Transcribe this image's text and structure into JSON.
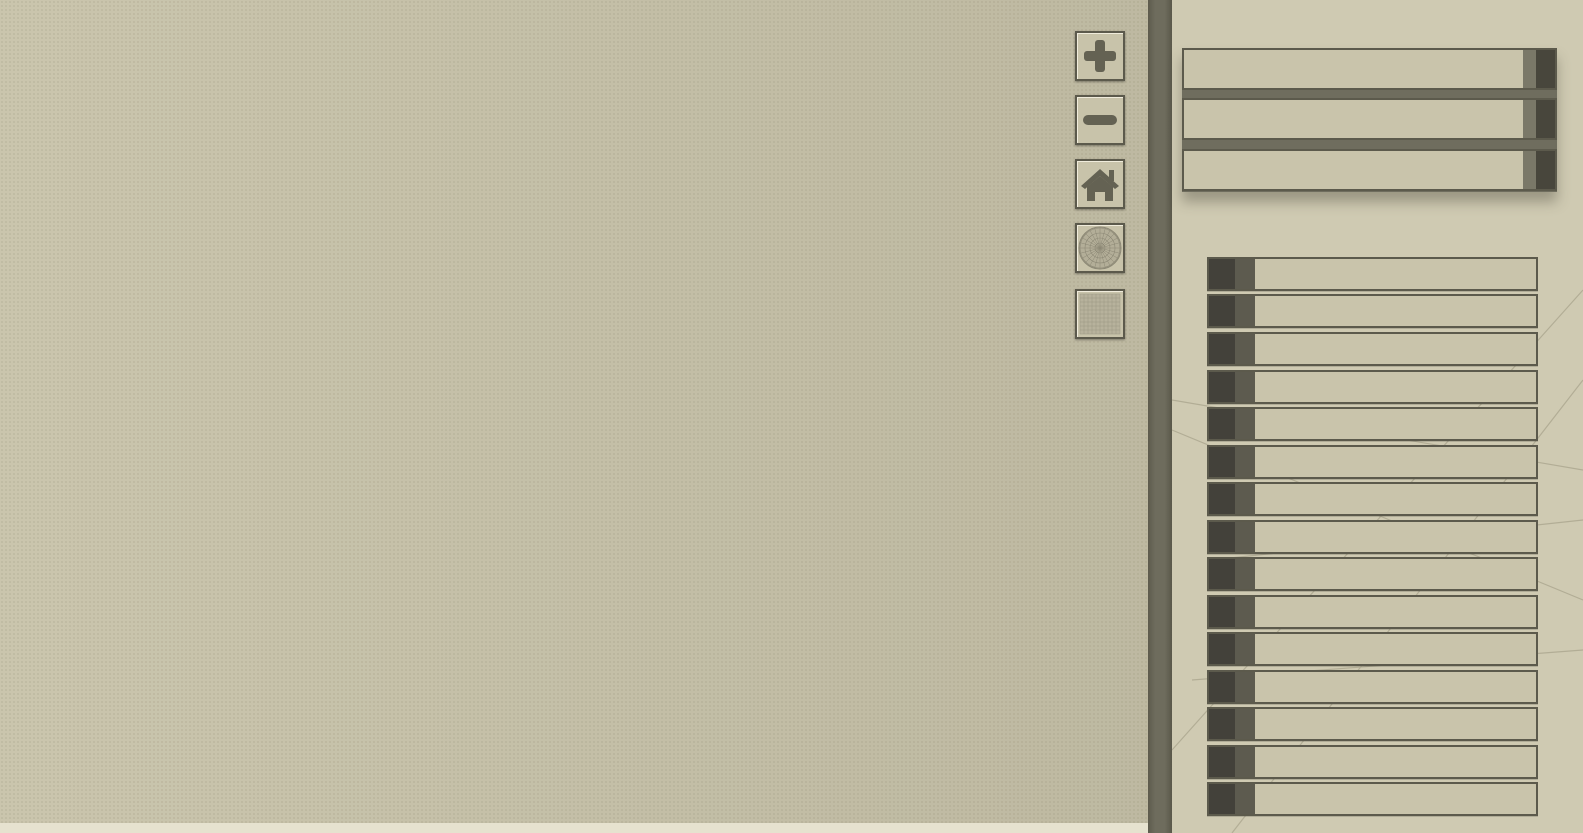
{
  "toolbar": {
    "buttons": [
      {
        "name": "zoom-in",
        "icon": "plus-icon"
      },
      {
        "name": "zoom-out",
        "icon": "minus-icon"
      },
      {
        "name": "home",
        "icon": "home-icon"
      },
      {
        "name": "radial-grid",
        "icon": "radial-grid-icon"
      },
      {
        "name": "square-grid",
        "icon": "square-grid-icon"
      }
    ]
  },
  "panel": {
    "top_bars": [
      "",
      "",
      ""
    ],
    "list_items": [
      "",
      "",
      "",
      "",
      "",
      "",
      "",
      "",
      "",
      "",
      "",
      "",
      "",
      "",
      ""
    ]
  },
  "colors": {
    "background": "#c9c4ab",
    "border": "#5c5a4c",
    "dark_accent": "#43413a",
    "divider": "#6e6c5d"
  }
}
